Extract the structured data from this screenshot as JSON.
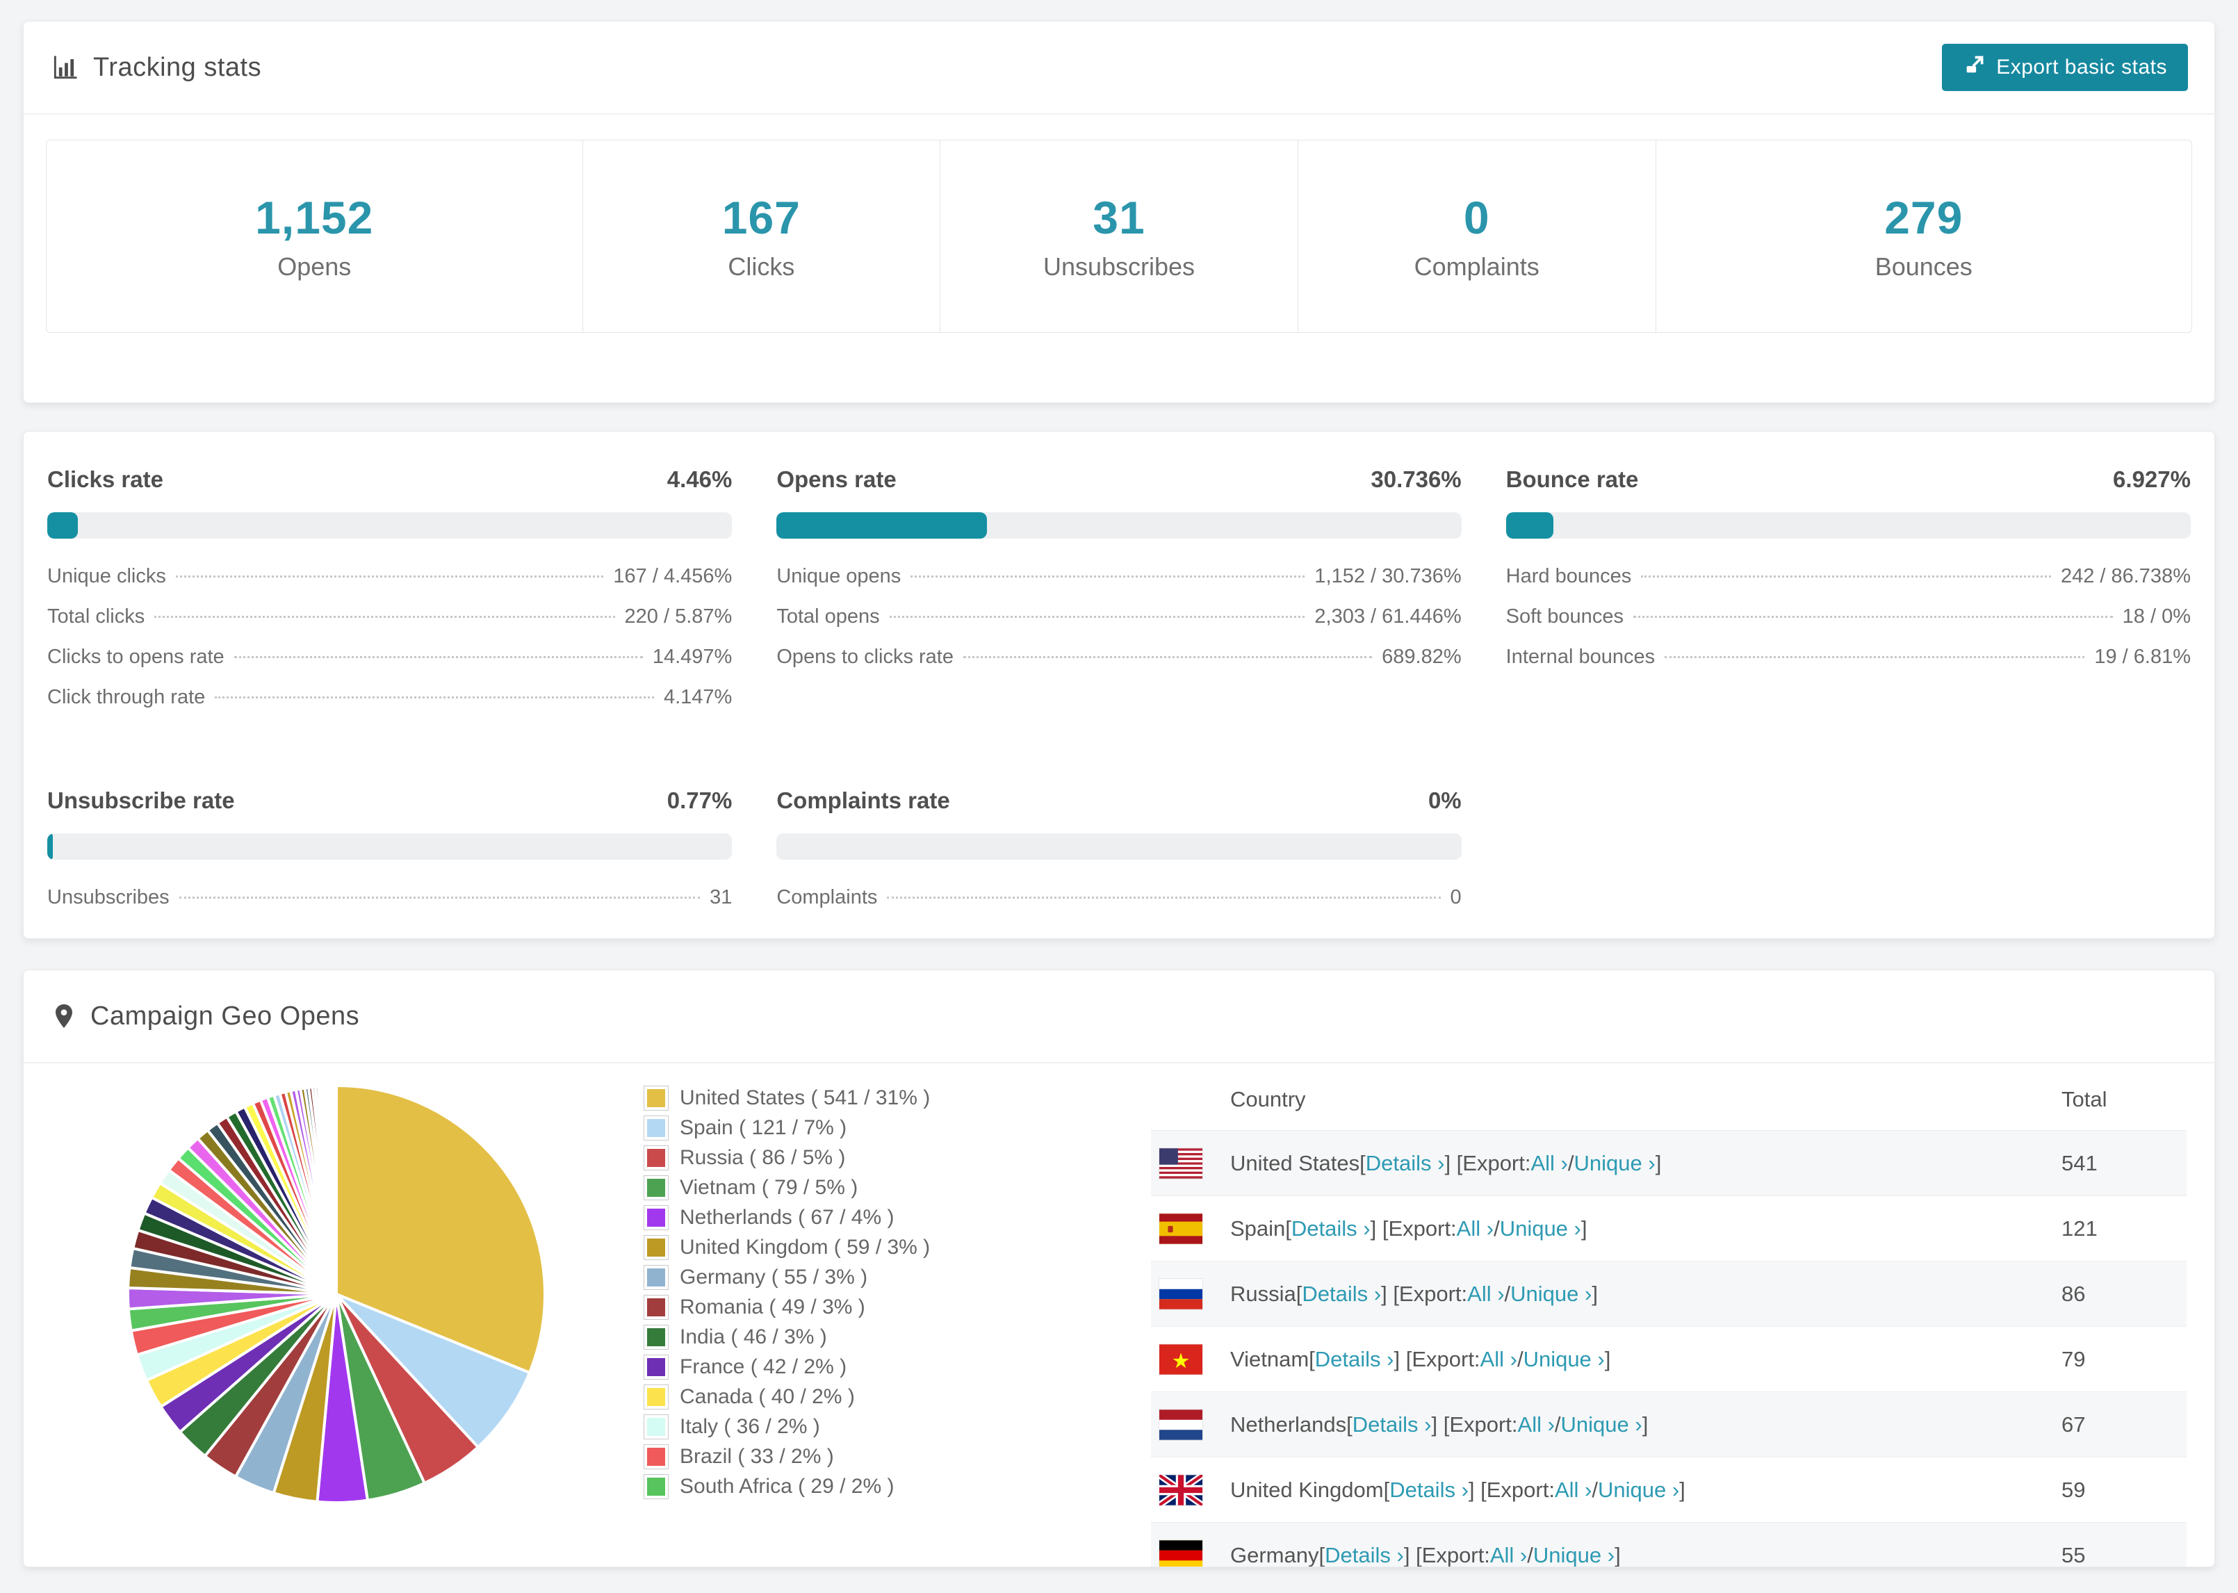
{
  "tracking": {
    "title": "Tracking stats",
    "export_button": "Export basic stats",
    "summary": [
      {
        "value": "1,152",
        "label": "Opens"
      },
      {
        "value": "167",
        "label": "Clicks"
      },
      {
        "value": "31",
        "label": "Unsubscribes"
      },
      {
        "value": "0",
        "label": "Complaints"
      },
      {
        "value": "279",
        "label": "Bounces"
      }
    ]
  },
  "rates": [
    {
      "title": "Clicks rate",
      "percent_label": "4.46%",
      "percent": 4.46,
      "rows": [
        {
          "label": "Unique clicks",
          "value": "167 / 4.456%"
        },
        {
          "label": "Total clicks",
          "value": "220 / 5.87%"
        },
        {
          "label": "Clicks to opens rate",
          "value": "14.497%"
        },
        {
          "label": "Click through rate",
          "value": "4.147%"
        }
      ]
    },
    {
      "title": "Opens rate",
      "percent_label": "30.736%",
      "percent": 30.736,
      "rows": [
        {
          "label": "Unique opens",
          "value": "1,152 / 30.736%"
        },
        {
          "label": "Total opens",
          "value": "2,303 / 61.446%"
        },
        {
          "label": "Opens to clicks rate",
          "value": "689.82%"
        }
      ]
    },
    {
      "title": "Bounce rate",
      "percent_label": "6.927%",
      "percent": 6.927,
      "rows": [
        {
          "label": "Hard bounces",
          "value": "242 / 86.738%"
        },
        {
          "label": "Soft bounces",
          "value": "18 / 0%"
        },
        {
          "label": "Internal bounces",
          "value": "19 / 6.81%"
        }
      ]
    },
    {
      "title": "Unsubscribe rate",
      "percent_label": "0.77%",
      "percent": 0.77,
      "rows": [
        {
          "label": "Unsubscribes",
          "value": "31"
        }
      ]
    },
    {
      "title": "Complaints rate",
      "percent_label": "0%",
      "percent": 0,
      "rows": [
        {
          "label": "Complaints",
          "value": "0"
        }
      ]
    }
  ],
  "geo": {
    "title": "Campaign Geo Opens",
    "table": {
      "country_header": "Country",
      "total_header": "Total",
      "link_parts": {
        "l1": "[",
        "details": "Details ›",
        "l2": "] [Export: ",
        "all": "All ›",
        "l3": " / ",
        "unique": "Unique ›",
        "l4": "]"
      },
      "rows": [
        {
          "country": "United States",
          "total": "541",
          "flag": "us"
        },
        {
          "country": "Spain",
          "total": "121",
          "flag": "es"
        },
        {
          "country": "Russia",
          "total": "86",
          "flag": "ru"
        },
        {
          "country": "Vietnam",
          "total": "79",
          "flag": "vn"
        },
        {
          "country": "Netherlands",
          "total": "67",
          "flag": "nl"
        },
        {
          "country": "United Kingdom",
          "total": "59",
          "flag": "gb"
        },
        {
          "country": "Germany",
          "total": "55",
          "flag": "de"
        }
      ]
    }
  },
  "chart_data": {
    "type": "pie",
    "title": "Campaign Geo Opens",
    "legend_position": "right",
    "start_angle_deg": -90,
    "direction": "clockwise",
    "series": [
      {
        "name": "United States",
        "value": 541,
        "pct": "31%",
        "color": "#e3bf46"
      },
      {
        "name": "Spain",
        "value": 121,
        "pct": "7%",
        "color": "#b3d8f4"
      },
      {
        "name": "Russia",
        "value": 86,
        "pct": "5%",
        "color": "#ca4a4c"
      },
      {
        "name": "Vietnam",
        "value": 79,
        "pct": "5%",
        "color": "#4da251"
      },
      {
        "name": "Netherlands",
        "value": 67,
        "pct": "4%",
        "color": "#a138ee"
      },
      {
        "name": "United Kingdom",
        "value": 59,
        "pct": "3%",
        "color": "#bd9a24"
      },
      {
        "name": "Germany",
        "value": 55,
        "pct": "3%",
        "color": "#90b3d0"
      },
      {
        "name": "Romania",
        "value": 49,
        "pct": "3%",
        "color": "#a23d3d"
      },
      {
        "name": "India",
        "value": 46,
        "pct": "3%",
        "color": "#357c3b"
      },
      {
        "name": "France",
        "value": 42,
        "pct": "2%",
        "color": "#6e2fb5"
      },
      {
        "name": "Canada",
        "value": 40,
        "pct": "2%",
        "color": "#fce34d"
      },
      {
        "name": "Italy",
        "value": 36,
        "pct": "2%",
        "color": "#d4fbf4"
      },
      {
        "name": "Brazil",
        "value": 33,
        "pct": "2%",
        "color": "#f05a5a"
      },
      {
        "name": "South Africa",
        "value": 29,
        "pct": "2%",
        "color": "#57c45e"
      }
    ],
    "others_unlabeled": {
      "values": [
        28,
        27,
        26,
        25,
        24,
        23,
        22,
        21,
        20,
        19,
        18,
        17,
        16,
        15,
        14,
        13,
        12,
        11,
        10,
        9,
        8,
        8,
        7,
        7,
        6,
        6,
        5,
        5,
        4,
        4,
        3,
        3,
        3,
        2,
        2,
        2,
        2,
        1,
        1,
        1,
        1,
        1,
        1,
        1
      ],
      "palette": [
        "#b35de8",
        "#97811f",
        "#53707f",
        "#7e2a2a",
        "#1e5a28",
        "#3a2a7a",
        "#f2ee4b",
        "#e2fbf2",
        "#f26060",
        "#5ade6e",
        "#e866ee",
        "#8a7a1f",
        "#36535f",
        "#93282f",
        "#236b2d",
        "#28216b",
        "#fdf84e",
        "#e04848",
        "#f063ef",
        "#64e072",
        "#aed3f2",
        "#d94545",
        "#c8a22a",
        "#b35de8"
      ]
    }
  }
}
